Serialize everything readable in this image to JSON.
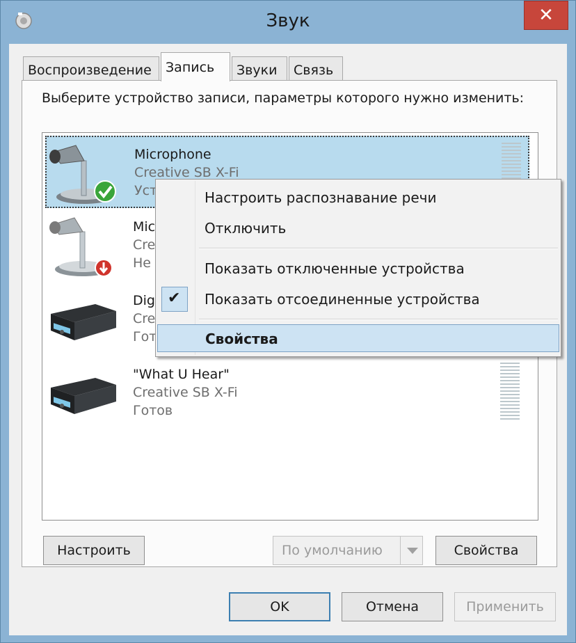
{
  "window": {
    "title": "Звук",
    "close_glyph": "✕"
  },
  "tabs": [
    {
      "label": "Воспроизведение",
      "active": false
    },
    {
      "label": "Запись",
      "active": true
    },
    {
      "label": "Звуки",
      "active": false
    },
    {
      "label": "Связь",
      "active": false
    }
  ],
  "instruction": "Выберите устройство записи, параметры которого нужно изменить:",
  "devices": [
    {
      "name": "Microphone",
      "subtitle": "Creative SB X-Fi",
      "status": "Устр",
      "icon": "microphone-default-icon",
      "selected": true
    },
    {
      "name": "Mic",
      "subtitle": "Crea",
      "status": "Не",
      "icon": "microphone-disconnected-icon",
      "selected": false
    },
    {
      "name": "Dig",
      "subtitle": "Cre",
      "status": "Гото",
      "icon": "sound-card-icon",
      "selected": false
    },
    {
      "name": "\"What U Hear\"",
      "subtitle": "Creative SB X-Fi",
      "status": "Готов",
      "icon": "sound-card-icon",
      "selected": false
    }
  ],
  "context_menu": {
    "items": [
      {
        "label": "Настроить распознавание речи",
        "checked": false,
        "highlighted": false
      },
      {
        "label": "Отключить",
        "checked": false,
        "highlighted": false
      },
      {
        "label": "Показать отключенные устройства",
        "checked": false,
        "highlighted": false
      },
      {
        "label": "Показать отсоединенные устройства",
        "checked": true,
        "highlighted": false
      },
      {
        "label": "Свойства",
        "checked": false,
        "highlighted": true
      }
    ],
    "check_glyph": "✔"
  },
  "panel_buttons": {
    "configure": "Настроить",
    "set_default": "По умолчанию",
    "properties": "Свойства"
  },
  "dialog_buttons": {
    "ok": "OK",
    "cancel": "Отмена",
    "apply": "Применить"
  },
  "colors": {
    "selection": "#b8dbee",
    "menu_highlight": "#cde3f3",
    "close_red": "#c7463b",
    "default_check_green": "#3aa53a",
    "disconnected_red": "#d0342c"
  }
}
